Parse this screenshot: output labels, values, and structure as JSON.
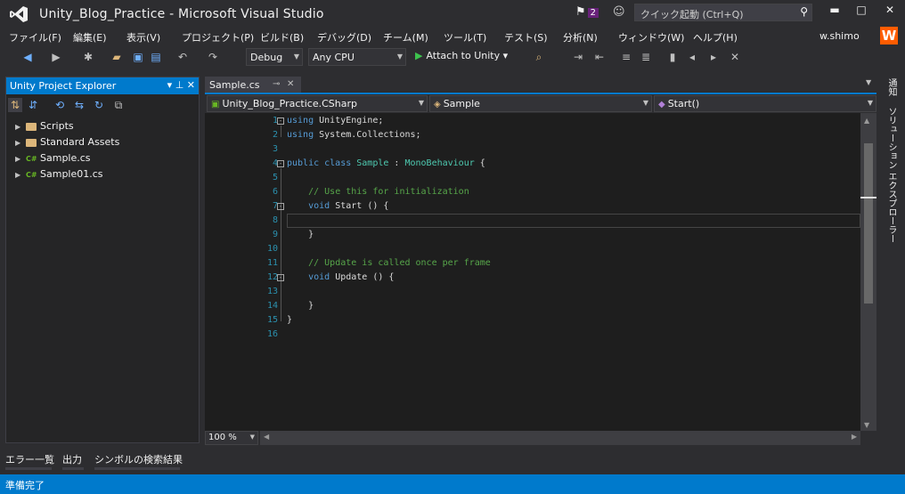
{
  "window": {
    "title": "Unity_Blog_Practice - Microsoft Visual Studio",
    "notification_count": "2",
    "quick_launch_placeholder": "クイック起動 (Ctrl+Q)",
    "minimize": "▬",
    "maximize": "□",
    "close": "✕"
  },
  "menu": {
    "items": [
      "ファイル(F)",
      "編集(E)",
      "表示(V)",
      "プロジェクト(P)",
      "ビルド(B)",
      "デバッグ(D)",
      "チーム(M)",
      "ツール(T)",
      "テスト(S)",
      "分析(N)",
      "ウィンドウ(W)",
      "ヘルプ(H)"
    ],
    "user": "w.shimo",
    "user_initial": "W"
  },
  "toolbar": {
    "config": "Debug",
    "platform": "Any CPU",
    "attach_label": "Attach to Unity"
  },
  "left_panel": {
    "title": "Unity Project Explorer",
    "items": [
      {
        "label": "Scripts",
        "kind": "folder"
      },
      {
        "label": "Standard Assets",
        "kind": "folder"
      },
      {
        "label": "Sample.cs",
        "kind": "cs"
      },
      {
        "label": "Sample01.cs",
        "kind": "cs"
      }
    ],
    "cs_icon": "C#"
  },
  "editor": {
    "tab_label": "Sample.cs",
    "nav_project": "Unity_Blog_Practice.CSharp",
    "nav_class": "Sample",
    "nav_member": "Start()",
    "zoom": "100 %",
    "line_numbers": [
      "1",
      "2",
      "3",
      "4",
      "5",
      "6",
      "7",
      "8",
      "9",
      "10",
      "11",
      "12",
      "13",
      "14",
      "15",
      "16"
    ],
    "code": {
      "l1_kw": "using",
      "l1_rest": " UnityEngine;",
      "l2_kw": "using",
      "l2_rest": " System.Collections;",
      "l4_kw": "public class",
      "l4_name": " Sample",
      "l4_colon": " : ",
      "l4_base": "MonoBehaviour",
      "l4_brace": " {",
      "l6_comment": "// Use this for initialization",
      "l7_kw": "void",
      "l7_rest": " Start () {",
      "l9": "}",
      "l11_comment": "// Update is called once per frame",
      "l12_kw": "void",
      "l12_rest": " Update () {",
      "l14": "}",
      "l15": "}"
    }
  },
  "side_tabs": [
    "通知",
    "ソリューション エクスプローラー"
  ],
  "bottom_tabs": [
    "エラー一覧",
    "出力",
    "シンボルの検索結果"
  ],
  "status": "準備完了",
  "colors": {
    "accent": "#007acc",
    "background": "#2d2d30",
    "editor_bg": "#1e1e1e",
    "keyword": "#569cd6",
    "type": "#4ec9b0",
    "comment": "#57a64a",
    "line_number": "#2b91af"
  }
}
